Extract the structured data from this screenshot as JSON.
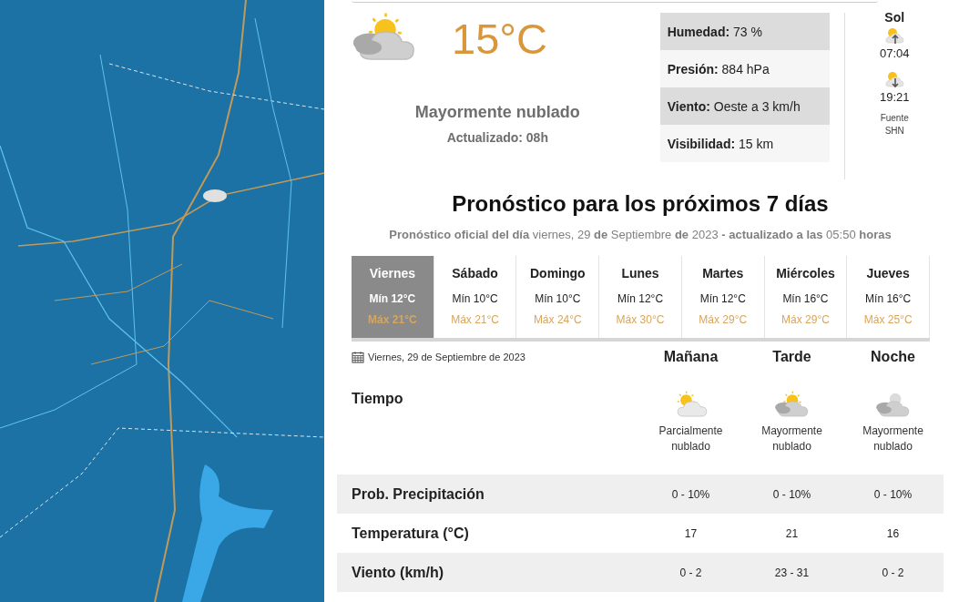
{
  "current": {
    "kind": "mostly",
    "temperature": "15°C",
    "condition": "Mayormente nublado",
    "updated": "Actualizado: 08h"
  },
  "details": [
    {
      "label": "Humedad:",
      "value": "73 %"
    },
    {
      "label": "Presión:",
      "value": "884 hPa"
    },
    {
      "label": "Viento:",
      "value": "Oeste a 3 km/h"
    },
    {
      "label": "Visibilidad:",
      "value": "15 km"
    }
  ],
  "sun": {
    "title": "Sol",
    "events": [
      {
        "kind": "rise",
        "time": "07:04"
      },
      {
        "kind": "set",
        "time": "19:21"
      }
    ],
    "source": "Fuente SHN"
  },
  "forecast": {
    "title": "Pronóstico para los próximos 7 días",
    "subtitle": "**Pronóstico oficial del día** viernes, 29 **de** Septiembre **de** 2023 **- actualizado a las** 05:50 **horas**",
    "days": [
      {
        "name": "Viernes",
        "min": "Mín 12°C",
        "max": "Máx 21°C",
        "selected": true
      },
      {
        "name": "Sábado",
        "min": "Mín 10°C",
        "max": "Máx 21°C",
        "selected": false
      },
      {
        "name": "Domingo",
        "min": "Mín 10°C",
        "max": "Máx 24°C",
        "selected": false
      },
      {
        "name": "Lunes",
        "min": "Mín 12°C",
        "max": "Máx 30°C",
        "selected": false
      },
      {
        "name": "Martes",
        "min": "Mín 12°C",
        "max": "Máx 29°C",
        "selected": false
      },
      {
        "name": "Miércoles",
        "min": "Mín 16°C",
        "max": "Máx 29°C",
        "selected": false
      },
      {
        "name": "Jueves",
        "min": "Mín 16°C",
        "max": "Máx 25°C",
        "selected": false
      }
    ]
  },
  "detail": {
    "date": "Viernes, 29 de Septiembre de 2023",
    "weather_label": "Tiempo",
    "periods": [
      {
        "name": "Mañana",
        "kind": "partly",
        "condition": "Parcialmente nublado"
      },
      {
        "name": "Tarde",
        "kind": "mostly",
        "condition": "Mayormente nublado"
      },
      {
        "name": "Noche",
        "kind": "night",
        "condition": "Mayormente nublado"
      }
    ],
    "rows": [
      {
        "label": "Prob. Precipitación",
        "values": [
          "0 - 10%",
          "0 - 10%",
          "0 - 10%"
        ]
      },
      {
        "label": "Temperatura (°C)",
        "values": [
          "17",
          "21",
          "16"
        ]
      },
      {
        "label": "Viento (km/h)",
        "values": [
          "0 - 2",
          "23 - 31",
          "0 - 2"
        ]
      }
    ]
  }
}
